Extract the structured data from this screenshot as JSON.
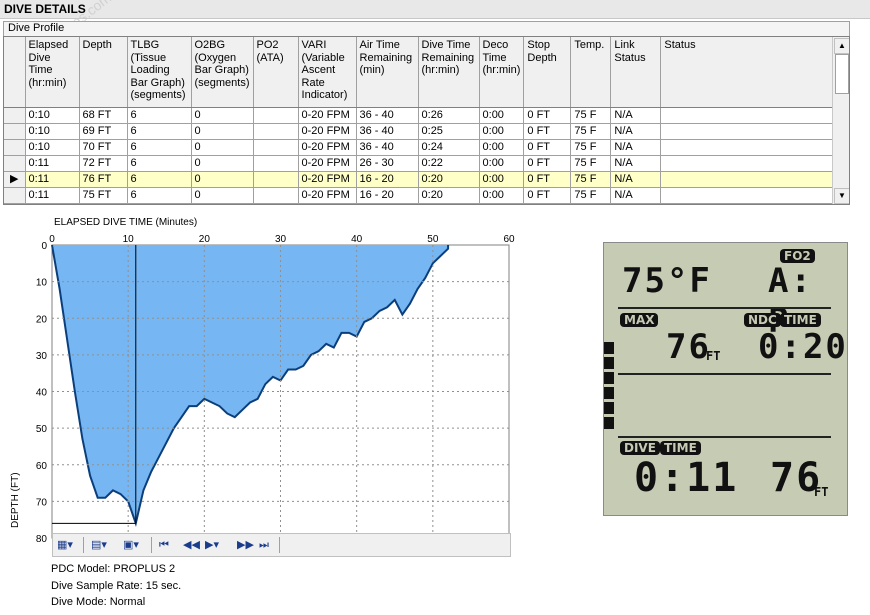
{
  "window": {
    "title": "DIVE DETAILS",
    "watermark": "WWW.Tdives.com"
  },
  "profile_group": {
    "label": "Dive Profile"
  },
  "table": {
    "columns": [
      "Elapsed Dive Time (hr:min)",
      "Depth",
      "TLBG (Tissue Loading Bar Graph) (segments)",
      "O2BG (Oxygen Bar Graph) (segments)",
      "PO2 (ATA)",
      "VARI (Variable Ascent Rate Indicator)",
      "Air Time Remaining (min)",
      "Dive Time Remaining (hr:min)",
      "Deco Time (hr:min)",
      "Stop Depth",
      "Temp.",
      "Link Status",
      "Status"
    ],
    "rows": [
      [
        "0:10",
        "68 FT",
        "6",
        "0",
        "",
        "0-20 FPM",
        "36 - 40",
        "0:26",
        "0:00",
        "0 FT",
        "75 F",
        "N/A",
        ""
      ],
      [
        "0:10",
        "69 FT",
        "6",
        "0",
        "",
        "0-20 FPM",
        "36 - 40",
        "0:25",
        "0:00",
        "0 FT",
        "75 F",
        "N/A",
        ""
      ],
      [
        "0:10",
        "70 FT",
        "6",
        "0",
        "",
        "0-20 FPM",
        "36 - 40",
        "0:24",
        "0:00",
        "0 FT",
        "75 F",
        "N/A",
        ""
      ],
      [
        "0:11",
        "72 FT",
        "6",
        "0",
        "",
        "0-20 FPM",
        "26 - 30",
        "0:22",
        "0:00",
        "0 FT",
        "75 F",
        "N/A",
        ""
      ],
      [
        "0:11",
        "76 FT",
        "6",
        "0",
        "",
        "0-20 FPM",
        "16 - 20",
        "0:20",
        "0:00",
        "0 FT",
        "75 F",
        "N/A",
        ""
      ],
      [
        "0:11",
        "75 FT",
        "6",
        "0",
        "",
        "0-20 FPM",
        "16 - 20",
        "0:20",
        "0:00",
        "0 FT",
        "75 F",
        "N/A",
        ""
      ]
    ],
    "selected_row": 4,
    "highlight_color": "#ffffc8"
  },
  "chart_data": {
    "type": "area",
    "title": "ELAPSED DIVE TIME (Minutes)",
    "xlabel": "ELAPSED DIVE TIME (Minutes)",
    "ylabel": "DEPTH (FT)",
    "xlim": [
      0,
      60
    ],
    "ylim": [
      0,
      80
    ],
    "y_inverted": true,
    "x_ticks": [
      "0",
      "10",
      "20",
      "30",
      "40",
      "50",
      "60"
    ],
    "y_ticks": [
      "0",
      "10",
      "20",
      "30",
      "40",
      "50",
      "60",
      "70",
      "80"
    ],
    "grid": true,
    "fill_color": "#76b6f2",
    "line_color": "#0b3f7c",
    "cursor_x": 11,
    "cursor_y": 76,
    "series": [
      {
        "x": [
          0,
          1,
          2,
          3,
          4,
          5,
          6,
          7,
          8,
          9,
          10,
          11,
          12,
          13,
          14,
          15,
          16,
          17,
          18,
          19,
          20,
          21,
          22,
          23,
          24,
          25,
          26,
          27,
          28,
          29,
          30,
          31,
          32,
          33,
          34,
          35,
          36,
          37,
          38,
          39,
          40,
          41,
          42,
          43,
          44,
          45,
          46,
          47,
          48,
          49,
          50,
          51,
          52,
          52
        ],
        "values": [
          0,
          12,
          26,
          40,
          53,
          63,
          69,
          69,
          67,
          68,
          70,
          76,
          67,
          62,
          58,
          54,
          50,
          47,
          44,
          44,
          42,
          43,
          44,
          46,
          47,
          45,
          43,
          42,
          38,
          36,
          37,
          34,
          34,
          33,
          30,
          29,
          27,
          28,
          24,
          24,
          25,
          21,
          20,
          18,
          17,
          15,
          19,
          16,
          12,
          9,
          5,
          3,
          1,
          0
        ]
      }
    ]
  },
  "toolbar": {
    "items": [
      {
        "name": "chart-color-icon",
        "label": "▦▾"
      },
      {
        "name": "export-icon",
        "label": "▤▾"
      },
      {
        "name": "image-icon",
        "label": "▣▾"
      },
      {
        "name": "first-icon",
        "label": "⏮"
      },
      {
        "name": "rewind-icon",
        "label": "◀◀"
      },
      {
        "name": "play-icon",
        "label": "▶▾"
      },
      {
        "name": "forward-icon",
        "label": "▶▶"
      },
      {
        "name": "last-icon",
        "label": "⏭"
      }
    ]
  },
  "info": {
    "model": "PDC Model: PROPLUS 2",
    "sample_rate": "Dive Sample Rate: 15 sec.",
    "mode": "Dive Mode: Normal"
  },
  "lcd": {
    "fo2_tag": "FO2",
    "temp": "75°F",
    "fo2_value": "A: P",
    "max_tag": "MAX",
    "max_depth": "76",
    "max_unit": "FT",
    "ndc_tag": "NDC",
    "time_tag": "TIME",
    "ndc_time": "0:20",
    "dive_tag": "DIVE",
    "dive_time_tag": "TIME",
    "dive_time": "0:11",
    "current_depth": "76",
    "depth_unit": "FT",
    "tlbg_segments": 6,
    "bg_color": "#c6cbb4"
  }
}
